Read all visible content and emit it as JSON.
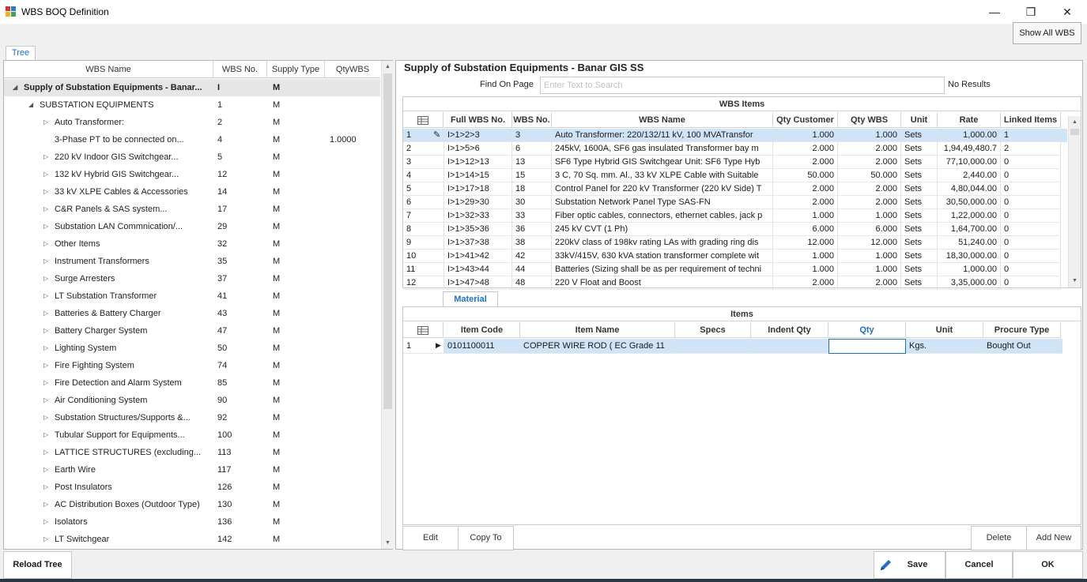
{
  "window": {
    "title": "WBS BOQ Definition",
    "minimize": "—",
    "restore": "❐",
    "close": "✕"
  },
  "toolbar": {
    "show_all_label": "Show All WBS"
  },
  "tree_tab": {
    "label": "Tree"
  },
  "tree": {
    "columns": [
      "WBS Name",
      "WBS No.",
      "Supply Type",
      "QtyWBS"
    ],
    "rows": [
      {
        "name": "Supply of Substation Equipments - Banar...",
        "no": "I",
        "supply": "M",
        "qty": "",
        "level": 0,
        "expander": "open",
        "selected": true
      },
      {
        "name": "SUBSTATION EQUIPMENTS",
        "no": "1",
        "supply": "M",
        "qty": "",
        "level": 1,
        "expander": "open"
      },
      {
        "name": "Auto Transformer:",
        "no": "2",
        "supply": "M",
        "qty": "",
        "level": 2,
        "expander": "closed"
      },
      {
        "name": "3-Phase PT to be connected on...",
        "no": "4",
        "supply": "M",
        "qty": "1.0000",
        "level": 2,
        "expander": "none"
      },
      {
        "name": "220 kV Indoor GIS Switchgear...",
        "no": "5",
        "supply": "M",
        "qty": "",
        "level": 2,
        "expander": "closed"
      },
      {
        "name": "132 kV Hybrid GIS Switchgear...",
        "no": "12",
        "supply": "M",
        "qty": "",
        "level": 2,
        "expander": "closed"
      },
      {
        "name": "33 kV XLPE Cables & Accessories",
        "no": "14",
        "supply": "M",
        "qty": "",
        "level": 2,
        "expander": "closed"
      },
      {
        "name": "C&R Panels & SAS system...",
        "no": "17",
        "supply": "M",
        "qty": "",
        "level": 2,
        "expander": "closed"
      },
      {
        "name": "Substation LAN Commnication/...",
        "no": "29",
        "supply": "M",
        "qty": "",
        "level": 2,
        "expander": "closed"
      },
      {
        "name": "Other Items",
        "no": "32",
        "supply": "M",
        "qty": "",
        "level": 2,
        "expander": "closed"
      },
      {
        "name": "Instrument Transformers",
        "no": "35",
        "supply": "M",
        "qty": "",
        "level": 2,
        "expander": "closed"
      },
      {
        "name": "Surge Arresters",
        "no": "37",
        "supply": "M",
        "qty": "",
        "level": 2,
        "expander": "closed"
      },
      {
        "name": "LT Substation Transformer",
        "no": "41",
        "supply": "M",
        "qty": "",
        "level": 2,
        "expander": "closed"
      },
      {
        "name": "Batteries & Battery Charger",
        "no": "43",
        "supply": "M",
        "qty": "",
        "level": 2,
        "expander": "closed"
      },
      {
        "name": "Battery Charger System",
        "no": "47",
        "supply": "M",
        "qty": "",
        "level": 2,
        "expander": "closed"
      },
      {
        "name": "Lighting System",
        "no": "50",
        "supply": "M",
        "qty": "",
        "level": 2,
        "expander": "closed"
      },
      {
        "name": "Fire Fighting System",
        "no": "74",
        "supply": "M",
        "qty": "",
        "level": 2,
        "expander": "closed"
      },
      {
        "name": "Fire Detection and Alarm System",
        "no": "85",
        "supply": "M",
        "qty": "",
        "level": 2,
        "expander": "closed"
      },
      {
        "name": "Air Conditioning System",
        "no": "90",
        "supply": "M",
        "qty": "",
        "level": 2,
        "expander": "closed"
      },
      {
        "name": "Substation Structures/Supports &...",
        "no": "92",
        "supply": "M",
        "qty": "",
        "level": 2,
        "expander": "closed"
      },
      {
        "name": "Tubular Support for Equipments...",
        "no": "100",
        "supply": "M",
        "qty": "",
        "level": 2,
        "expander": "closed"
      },
      {
        "name": "LATTICE STRUCTURES (excluding...",
        "no": "113",
        "supply": "M",
        "qty": "",
        "level": 2,
        "expander": "closed"
      },
      {
        "name": "Earth Wire",
        "no": "117",
        "supply": "M",
        "qty": "",
        "level": 2,
        "expander": "closed"
      },
      {
        "name": "Post Insulators",
        "no": "126",
        "supply": "M",
        "qty": "",
        "level": 2,
        "expander": "closed"
      },
      {
        "name": "AC Distribution Boxes (Outdoor Type)",
        "no": "130",
        "supply": "M",
        "qty": "",
        "level": 2,
        "expander": "closed"
      },
      {
        "name": "Isolators",
        "no": "136",
        "supply": "M",
        "qty": "",
        "level": 2,
        "expander": "closed"
      },
      {
        "name": "LT Switchgear",
        "no": "142",
        "supply": "M",
        "qty": "",
        "level": 2,
        "expander": "closed"
      }
    ]
  },
  "right": {
    "title": "Supply of Substation Equipments - Banar GIS SS",
    "find_label": "Find On Page",
    "find_placeholder": "Enter Text to Search",
    "no_results": "No Results",
    "wbs_items": {
      "caption": "WBS Items",
      "columns": [
        "Full WBS No.",
        "WBS No.",
        "WBS Name",
        "Qty Customer",
        "Qty WBS",
        "Unit",
        "Rate",
        "Linked Items"
      ],
      "rows": [
        {
          "n": "1",
          "full": "I>1>2>3",
          "no": "3",
          "name": "Auto Transformer: 220/132/11 kV, 100 MVATransfor",
          "qc": "1.000",
          "qw": "1.000",
          "unit": "Sets",
          "rate": "1,000.00",
          "linked": "1",
          "selected": true
        },
        {
          "n": "2",
          "full": "I>1>5>6",
          "no": "6",
          "name": "245kV, 1600A, SF6 gas insulated Transformer bay m",
          "qc": "2.000",
          "qw": "2.000",
          "unit": "Sets",
          "rate": "1,94,49,480.7",
          "linked": "2"
        },
        {
          "n": "3",
          "full": "I>1>12>13",
          "no": "13",
          "name": "SF6 Type Hybrid GIS Switchgear Unit: SF6 Type Hyb",
          "qc": "2.000",
          "qw": "2.000",
          "unit": "Sets",
          "rate": "77,10,000.00",
          "linked": "0"
        },
        {
          "n": "4",
          "full": "I>1>14>15",
          "no": "15",
          "name": "3 C, 70 Sq. mm. Al., 33 kV XLPE Cable with Suitable",
          "qc": "50.000",
          "qw": "50.000",
          "unit": "Sets",
          "rate": "2,440.00",
          "linked": "0"
        },
        {
          "n": "5",
          "full": "I>1>17>18",
          "no": "18",
          "name": "Control Panel for 220 kV Transformer (220 kV Side) T",
          "qc": "2.000",
          "qw": "2.000",
          "unit": "Sets",
          "rate": "4,80,044.00",
          "linked": "0"
        },
        {
          "n": "6",
          "full": "I>1>29>30",
          "no": "30",
          "name": "Substation Network Panel Type SAS-FN",
          "qc": "2.000",
          "qw": "2.000",
          "unit": "Sets",
          "rate": "30,50,000.00",
          "linked": "0"
        },
        {
          "n": "7",
          "full": "I>1>32>33",
          "no": "33",
          "name": "Fiber optic cables, connectors, ethernet cables, jack p",
          "qc": "1.000",
          "qw": "1.000",
          "unit": "Sets",
          "rate": "1,22,000.00",
          "linked": "0"
        },
        {
          "n": "8",
          "full": "I>1>35>36",
          "no": "36",
          "name": "245 kV CVT (1 Ph)",
          "qc": "6.000",
          "qw": "6.000",
          "unit": "Sets",
          "rate": "1,64,700.00",
          "linked": "0"
        },
        {
          "n": "9",
          "full": "I>1>37>38",
          "no": "38",
          "name": "220kV class  of 198kv rating LAs with grading ring dis",
          "qc": "12.000",
          "qw": "12.000",
          "unit": "Sets",
          "rate": "51,240.00",
          "linked": "0"
        },
        {
          "n": "10",
          "full": "I>1>41>42",
          "no": "42",
          "name": "33kV/415V, 630 kVA station transformer complete wit",
          "qc": "1.000",
          "qw": "1.000",
          "unit": "Sets",
          "rate": "18,30,000.00",
          "linked": "0"
        },
        {
          "n": "11",
          "full": "I>1>43>44",
          "no": "44",
          "name": "Batteries (Sizing shall be as per requirement of techni",
          "qc": "1.000",
          "qw": "1.000",
          "unit": "Sets",
          "rate": "1,000.00",
          "linked": "0"
        },
        {
          "n": "12",
          "full": "I>1>47>48",
          "no": "48",
          "name": "220 V Float and Boost",
          "qc": "2.000",
          "qw": "2.000",
          "unit": "Sets",
          "rate": "3,35,000.00",
          "linked": "0"
        }
      ]
    },
    "material_tab": "Material",
    "items": {
      "caption": "Items",
      "columns": [
        "Item Code",
        "Item Name",
        "Specs",
        "Indent Qty",
        "Qty",
        "Unit",
        "Procure Type"
      ],
      "rows": [
        {
          "n": "1",
          "code": "0101100011",
          "name": "COPPER WIRE ROD ( EC Grade 11",
          "specs": "",
          "indent": "",
          "qty": "",
          "unit": "Kgs.",
          "procure": "Bought Out"
        }
      ]
    },
    "buttons": {
      "edit": "Edit",
      "copy_to": "Copy To",
      "delete": "Delete",
      "add_new": "Add New"
    }
  },
  "footer": {
    "reload": "Reload Tree",
    "save": "Save",
    "cancel": "Cancel",
    "ok": "OK"
  }
}
